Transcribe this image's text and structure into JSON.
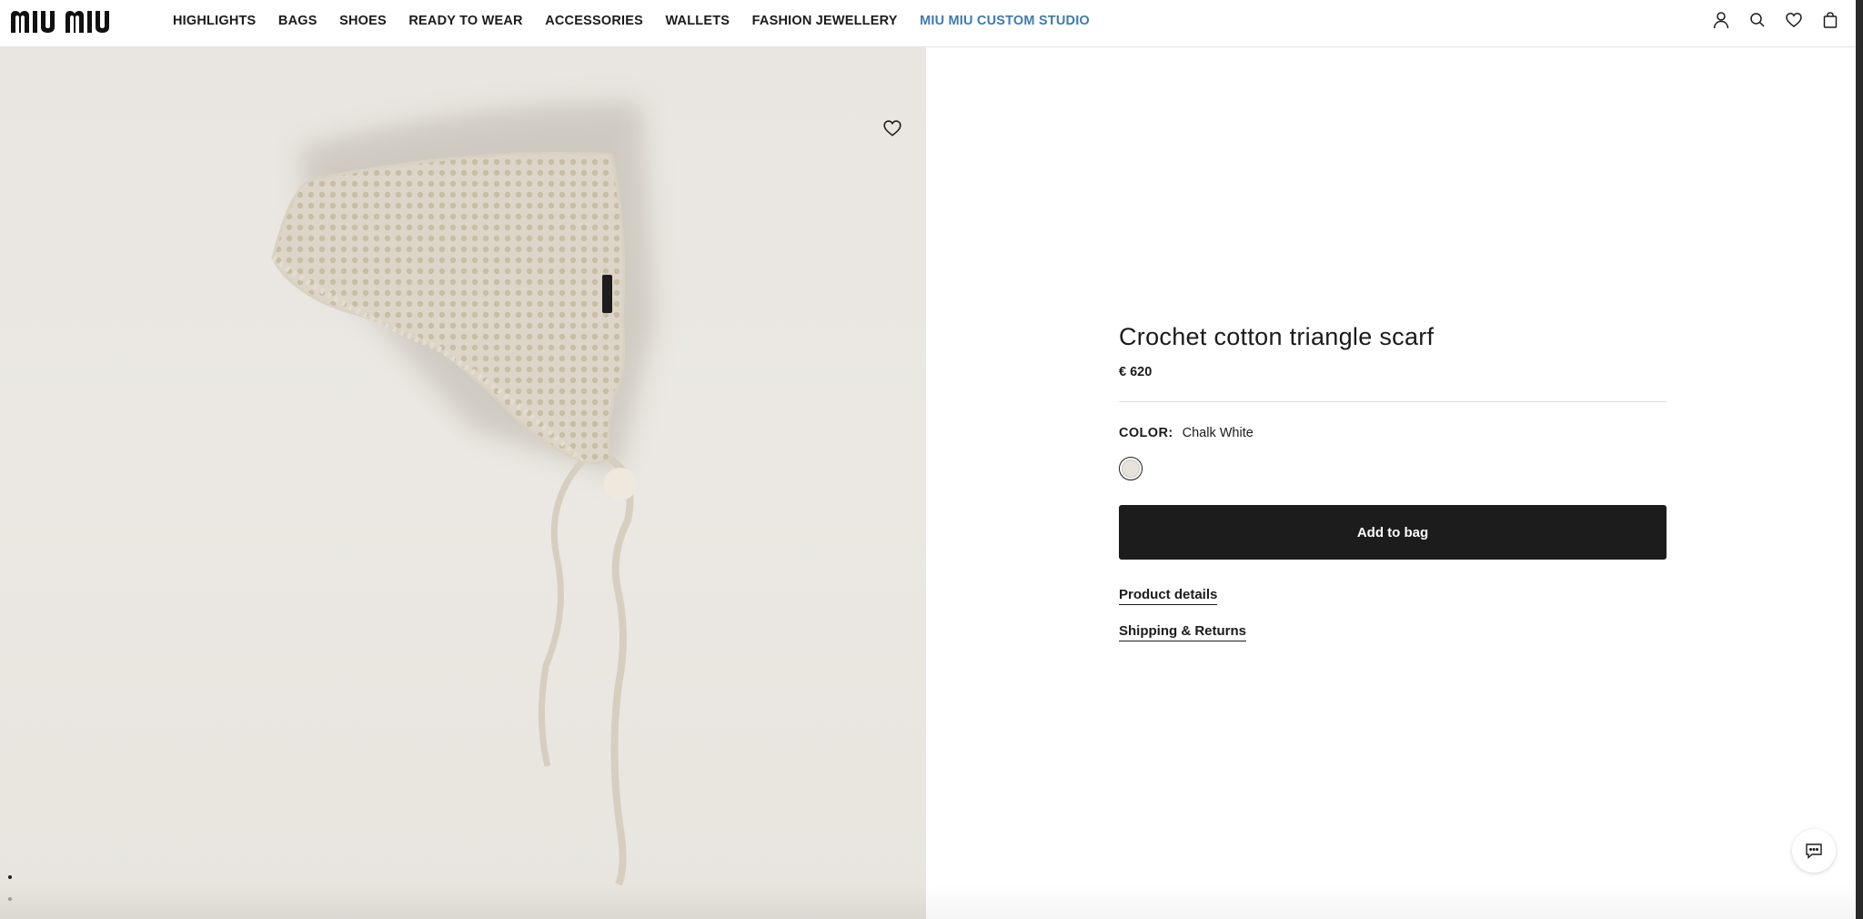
{
  "brand": {
    "logo_text": "MIU MIU"
  },
  "nav": {
    "items": [
      {
        "label": "HIGHLIGHTS"
      },
      {
        "label": "BAGS"
      },
      {
        "label": "SHOES"
      },
      {
        "label": "READY TO WEAR"
      },
      {
        "label": "ACCESSORIES"
      },
      {
        "label": "WALLETS"
      },
      {
        "label": "FASHION JEWELLERY"
      },
      {
        "label": "MIU MIU CUSTOM STUDIO"
      }
    ],
    "accent_color": "#3e7ab2"
  },
  "header_icons": [
    "account-icon",
    "search-icon",
    "wishlist-icon",
    "bag-icon"
  ],
  "product": {
    "title": "Crochet cotton triangle scarf",
    "price": "€ 620",
    "color_label": "COLOR:",
    "color_value": "Chalk White",
    "swatch_color": "#e5e3dc",
    "add_to_bag": "Add to bag",
    "links": [
      "Product details",
      "Shipping & Returns"
    ]
  },
  "gallery": {
    "image_alt": "crochet scarf product image",
    "slides": 2,
    "active_slide": 1
  },
  "chat": {
    "icon": "chat-icon"
  }
}
